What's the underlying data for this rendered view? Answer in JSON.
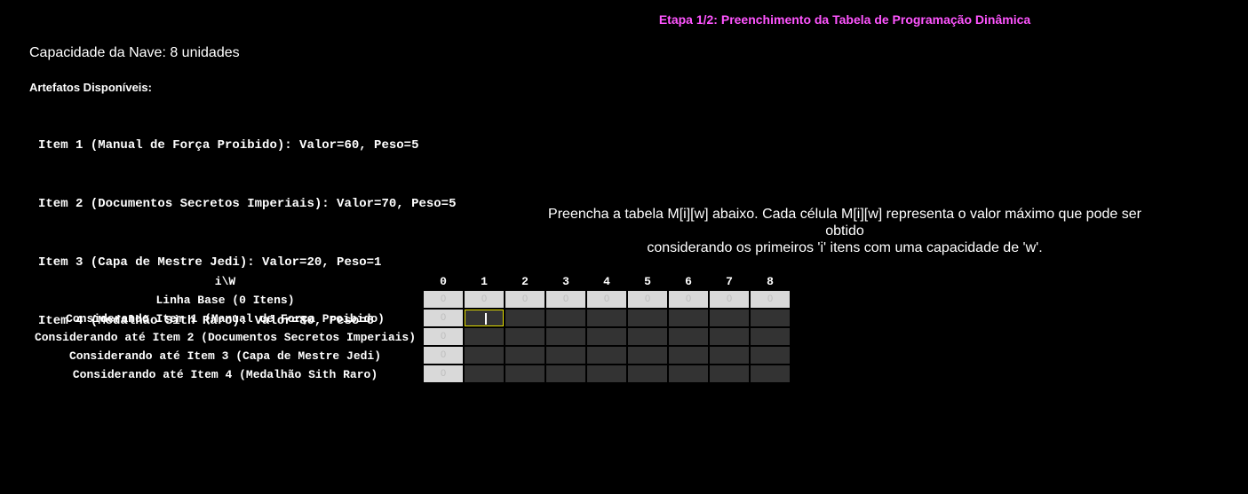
{
  "header": {
    "stage_title": "Etapa 1/2: Preenchimento da Tabela de Programação Dinâmica"
  },
  "capacity": "Capacidade da Nave: 8 unidades",
  "artifacts": {
    "title": "Artefatos Disponíveis:",
    "items": [
      "Item 1 (Manual de Força Proibido): Valor=60, Peso=5",
      "Item 2 (Documentos Secretos Imperiais): Valor=70, Peso=5",
      "Item 3 (Capa de Mestre Jedi): Valor=20, Peso=1",
      "Item 4 (Medalhão Sith Raro): Valor=80, Peso=6"
    ]
  },
  "instructions": {
    "line1": "Preencha a tabela M[i][w] abaixo. Cada célula M[i][w] representa o valor máximo que pode ser obtido",
    "line2": "considerando os primeiros 'i' itens com uma capacidade de 'w'."
  },
  "table": {
    "corner_label": "i\\W",
    "columns": [
      "0",
      "1",
      "2",
      "3",
      "4",
      "5",
      "6",
      "7",
      "8"
    ],
    "rows": [
      {
        "label": "Linha Base (0 Itens)",
        "cells": [
          "0",
          "0",
          "0",
          "0",
          "0",
          "0",
          "0",
          "0",
          "0"
        ]
      },
      {
        "label": "Considerando Item 1 (Manual de Força Proibido)",
        "cells": [
          "0",
          "",
          "",
          "",
          "",
          "",
          "",
          "",
          ""
        ]
      },
      {
        "label": "Considerando até Item 2 (Documentos Secretos Imperiais)",
        "cells": [
          "0",
          "",
          "",
          "",
          "",
          "",
          "",
          "",
          ""
        ]
      },
      {
        "label": "Considerando até Item 3 (Capa de Mestre Jedi)",
        "cells": [
          "0",
          "",
          "",
          "",
          "",
          "",
          "",
          "",
          ""
        ]
      },
      {
        "label": "Considerando até Item 4 (Medalhão Sith Raro)",
        "cells": [
          "0",
          "",
          "",
          "",
          "",
          "",
          "",
          "",
          ""
        ]
      }
    ],
    "active_cell": {
      "row": 1,
      "col": 1
    }
  }
}
